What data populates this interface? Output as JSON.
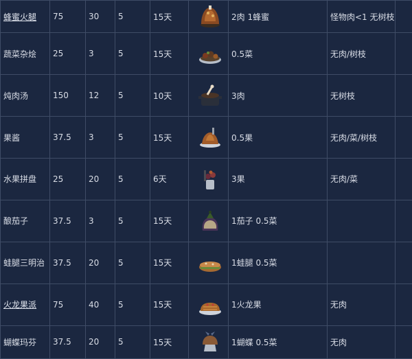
{
  "rows": [
    {
      "name": "蜂蜜火腿",
      "hunger": "75",
      "health": "30",
      "sanity": "5",
      "spoil": "15天",
      "icon": "honey-ham-icon",
      "ingredients": "2肉 1蜂蜜",
      "restrictions": "怪物肉<1 无树枝",
      "linked": true
    },
    {
      "name": "蔬菜杂烩",
      "hunger": "25",
      "health": "3",
      "sanity": "5",
      "spoil": "15天",
      "icon": "ratatouille-icon",
      "ingredients": "0.5菜",
      "restrictions": "无肉/树枝",
      "linked": false
    },
    {
      "name": "炖肉汤",
      "hunger": "150",
      "health": "12",
      "sanity": "5",
      "spoil": "10天",
      "icon": "meaty-stew-icon",
      "ingredients": "3肉",
      "restrictions": "无树枝",
      "linked": false
    },
    {
      "name": "果酱",
      "hunger": "37.5",
      "health": "3",
      "sanity": "5",
      "spoil": "15天",
      "icon": "fist-full-of-jam-icon",
      "ingredients": "0.5果",
      "restrictions": "无肉/菜/树枝",
      "linked": false
    },
    {
      "name": "水果拼盘",
      "hunger": "25",
      "health": "20",
      "sanity": "5",
      "spoil": "6天",
      "icon": "fruit-medley-icon",
      "ingredients": "3果",
      "restrictions": "无肉/菜",
      "linked": false
    },
    {
      "name": "酿茄子",
      "hunger": "37.5",
      "health": "3",
      "sanity": "5",
      "spoil": "15天",
      "icon": "stuffed-eggplant-icon",
      "ingredients": "1茄子 0.5菜",
      "restrictions": "",
      "linked": false
    },
    {
      "name": "蛙腿三明治",
      "hunger": "37.5",
      "health": "20",
      "sanity": "5",
      "spoil": "15天",
      "icon": "froggle-bunwich-icon",
      "ingredients": "1蛙腿 0.5菜",
      "restrictions": "",
      "linked": false
    },
    {
      "name": "火龙果派",
      "hunger": "75",
      "health": "40",
      "sanity": "5",
      "spoil": "15天",
      "icon": "dragonpie-icon",
      "ingredients": "1火龙果",
      "restrictions": "无肉",
      "linked": true
    },
    {
      "name": "蝴蝶玛芬",
      "hunger": "37.5",
      "health": "20",
      "sanity": "5",
      "spoil": "15天",
      "icon": "butter-muffin-icon",
      "ingredients": "1蝴蝶 0.5菜",
      "restrictions": "无肉",
      "linked": false
    }
  ]
}
